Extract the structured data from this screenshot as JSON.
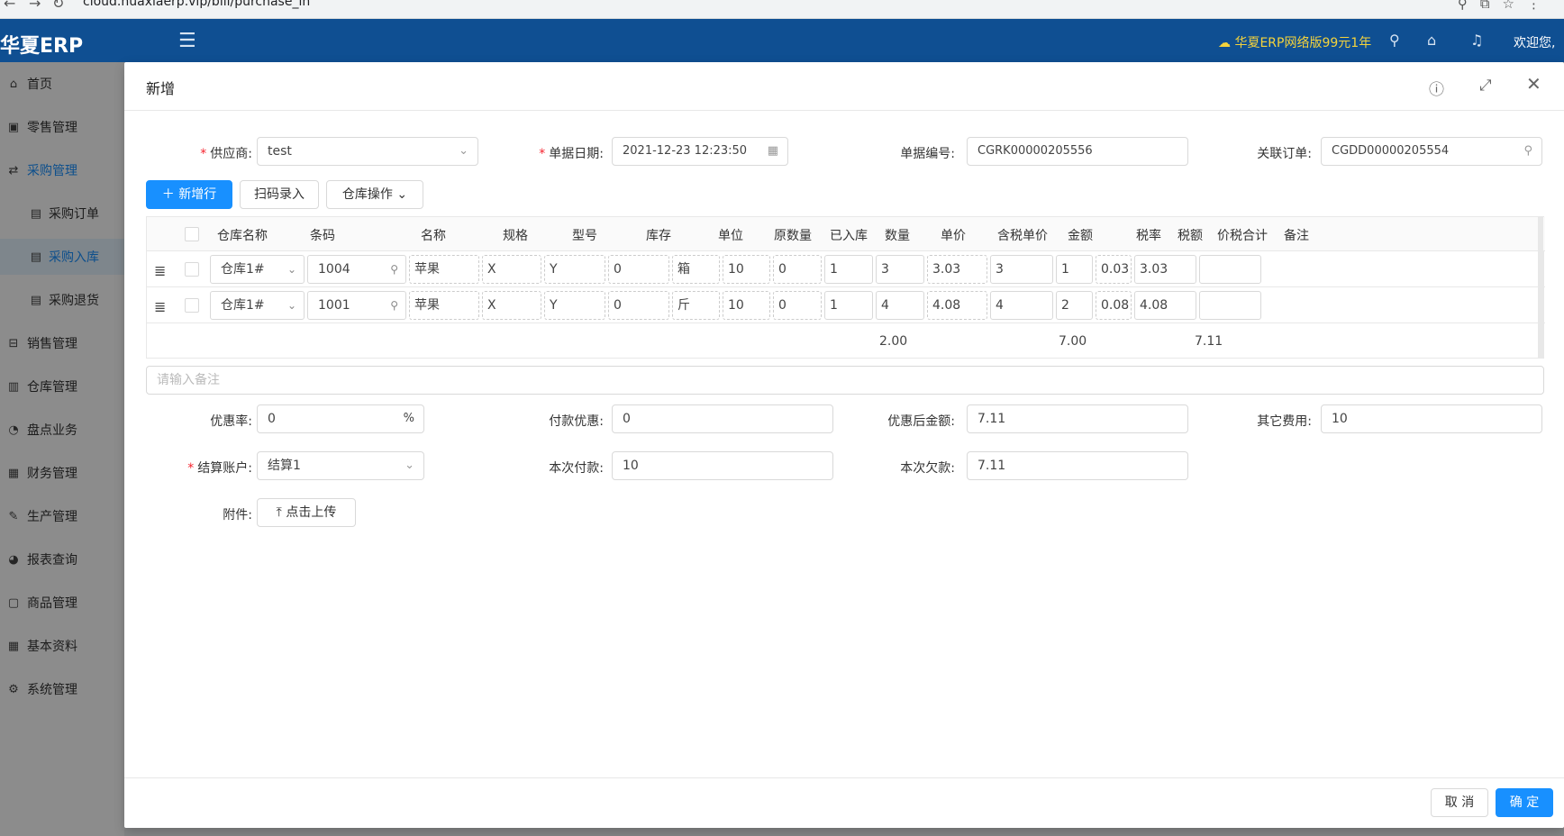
{
  "browser": {
    "url": "cloud.huaxiaerp.vip/bill/purchase_in"
  },
  "header": {
    "logo": "华夏ERP",
    "promo": "华夏ERP网络版99元1年",
    "welcome": "欢迎您,"
  },
  "sidebar": {
    "items": [
      {
        "label": "首页",
        "icon": "home-icon",
        "glyph": "⌂"
      },
      {
        "label": "零售管理",
        "icon": "gift-icon",
        "glyph": "▣"
      },
      {
        "label": "采购管理",
        "icon": "swap-icon",
        "glyph": "⇄"
      },
      {
        "label": "采购订单",
        "icon": "list-icon",
        "glyph": "▤"
      },
      {
        "label": "采购入库",
        "icon": "list-icon",
        "glyph": "▤"
      },
      {
        "label": "采购退货",
        "icon": "list-icon",
        "glyph": "▤"
      },
      {
        "label": "销售管理",
        "icon": "cart-icon",
        "glyph": "⊟"
      },
      {
        "label": "仓库管理",
        "icon": "book-icon",
        "glyph": "▥"
      },
      {
        "label": "盘点业务",
        "icon": "dashboard-icon",
        "glyph": "◔"
      },
      {
        "label": "财务管理",
        "icon": "finance-icon",
        "glyph": "▦"
      },
      {
        "label": "生产管理",
        "icon": "tool-icon",
        "glyph": "✎"
      },
      {
        "label": "报表查询",
        "icon": "pie-chart-icon",
        "glyph": "◕"
      },
      {
        "label": "商品管理",
        "icon": "shopping-icon",
        "glyph": "▢"
      },
      {
        "label": "基本资料",
        "icon": "appstore-icon",
        "glyph": "▦"
      },
      {
        "label": "系统管理",
        "icon": "setting-icon",
        "glyph": "⚙"
      }
    ]
  },
  "modal": {
    "title": "新增",
    "form": {
      "supplier_label": "供应商",
      "supplier_value": "test",
      "date_label": "单据日期",
      "date_value": "2021-12-23 12:23:50",
      "number_label": "单据编号",
      "number_value": "CGRK00000205556",
      "link_label": "关联订单",
      "link_value": "CGDD00000205554"
    },
    "toolbar": {
      "add_row": "新增行",
      "scan": "扫码录入",
      "warehouse_op": "仓库操作"
    },
    "table": {
      "columns": [
        "仓库名称",
        "条码",
        "名称",
        "规格",
        "型号",
        "库存",
        "单位",
        "原数量",
        "已入库",
        "数量",
        "单价",
        "含税单价",
        "金额",
        "税率",
        "税额",
        "价税合计",
        "备注"
      ],
      "rows": [
        {
          "warehouse": "仓库1#",
          "barcode": "1004",
          "name": "苹果",
          "spec": "X",
          "model": "Y",
          "stock": "0",
          "unit": "箱",
          "orig_qty": "10",
          "in_qty": "0",
          "qty": "1",
          "price": "3",
          "tax_price": "3.03",
          "amount": "3",
          "tax_rate": "1",
          "tax": "0.03",
          "total": "3.03",
          "remark": ""
        },
        {
          "warehouse": "仓库1#",
          "barcode": "1001",
          "name": "苹果",
          "spec": "X",
          "model": "Y",
          "stock": "0",
          "unit": "斤",
          "orig_qty": "10",
          "in_qty": "0",
          "qty": "1",
          "price": "4",
          "tax_price": "4.08",
          "amount": "4",
          "tax_rate": "2",
          "tax": "0.08",
          "total": "4.08",
          "remark": ""
        }
      ],
      "summary": {
        "qty": "2.00",
        "amount": "7.00",
        "total": "7.11"
      }
    },
    "remark_placeholder": "请输入备注",
    "fields": {
      "discount_rate_label": "优惠率",
      "discount_rate_value": "0",
      "discount_rate_suffix": "%",
      "pay_discount_label": "付款优惠",
      "pay_discount_value": "0",
      "after_discount_label": "优惠后金额",
      "after_discount_value": "7.11",
      "other_fee_label": "其它费用",
      "other_fee_value": "10",
      "account_label": "结算账户",
      "account_value": "结算1",
      "pay_now_label": "本次付款",
      "pay_now_value": "10",
      "debt_label": "本次欠款",
      "debt_value": "7.11",
      "attachment_label": "附件",
      "upload_label": "点击上传"
    },
    "footer": {
      "cancel": "取 消",
      "ok": "确 定"
    }
  }
}
